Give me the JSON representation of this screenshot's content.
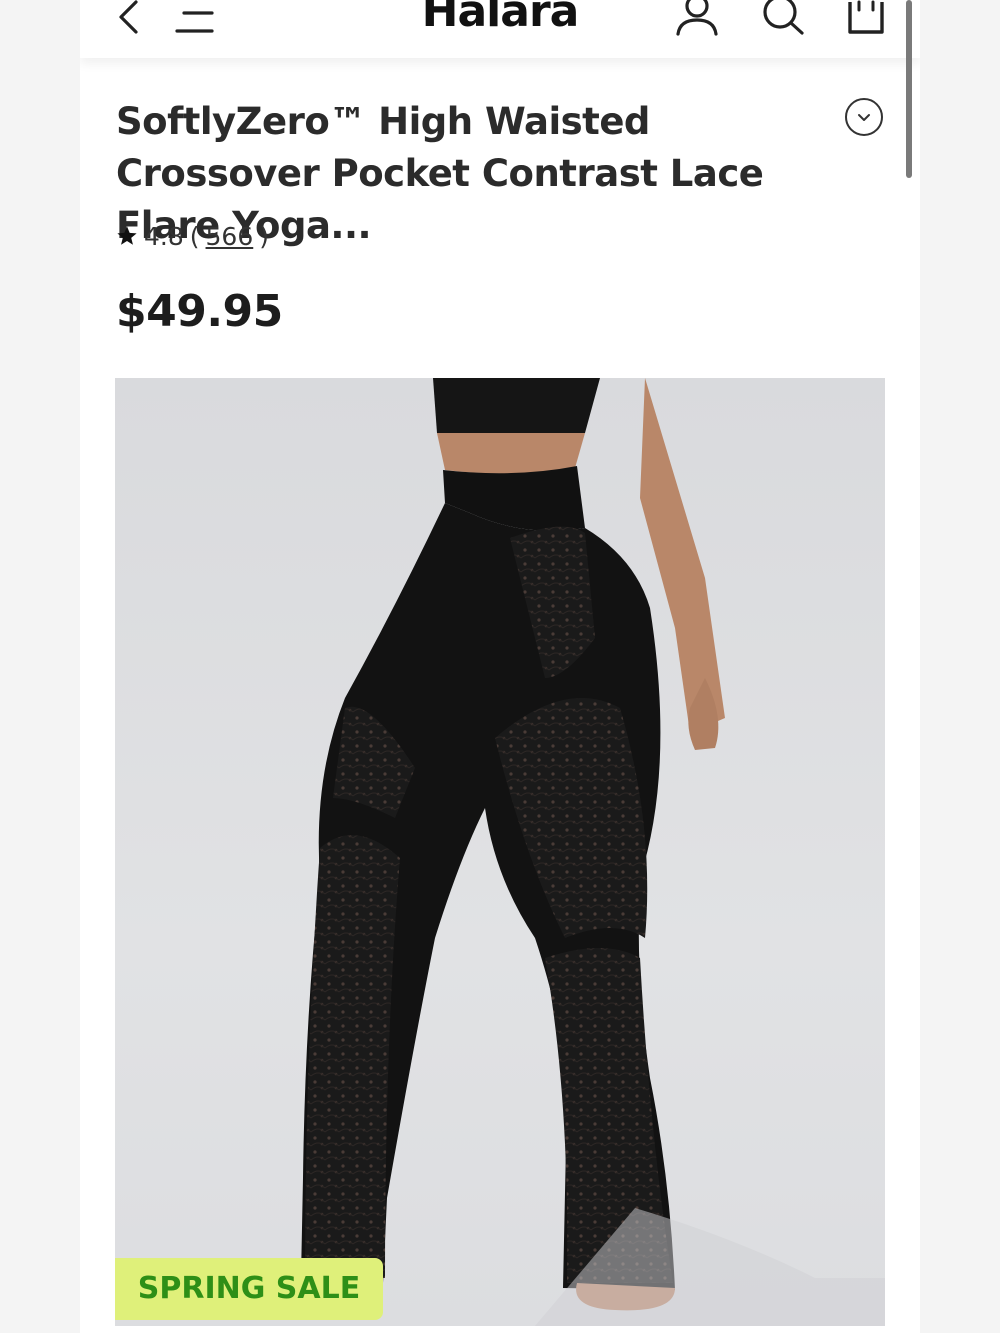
{
  "header": {
    "brand": "Halara",
    "icons": [
      "back-arrow-icon",
      "menu-icon",
      "account-icon",
      "search-icon",
      "shopping-bag-icon"
    ]
  },
  "product": {
    "title": "SoftlyZero™ High Waisted Crossover Pocket Contrast Lace Flare Yoga...",
    "rating": "4.8",
    "review_count": "566",
    "price": "$49.95",
    "badge": "SPRING SALE",
    "image_subject": "black high waisted crossover lace flare yoga pants"
  },
  "colors": {
    "badge_background": "#dff07a",
    "badge_text": "#2e8f17",
    "image_background": "#dcdde0"
  }
}
